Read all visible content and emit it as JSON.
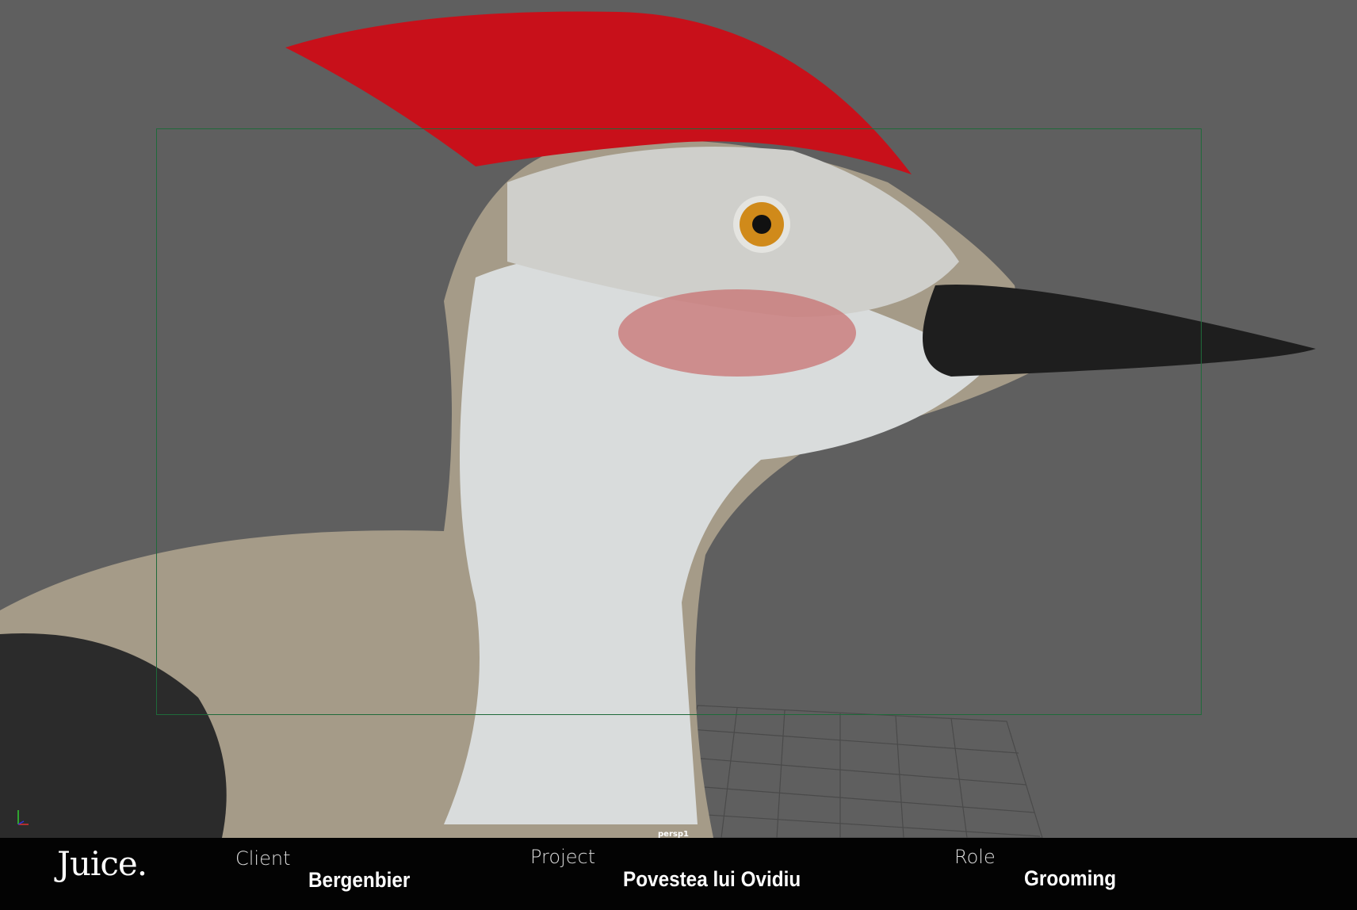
{
  "viewport": {
    "camera": "persp1",
    "axis": {
      "y": "y",
      "x": "x"
    }
  },
  "footer": {
    "logo": "Juice.",
    "client_label": "Client",
    "client_value": "Bergenbier",
    "project_label": "Project",
    "project_value": "Povestea lui Ovidiu",
    "role_label": "Role",
    "role_value": "Grooming"
  },
  "colors": {
    "background": "#5f5f5f",
    "crest": "#c8101a",
    "safe_frame": "#1f6a3a",
    "footer": "#030303"
  }
}
